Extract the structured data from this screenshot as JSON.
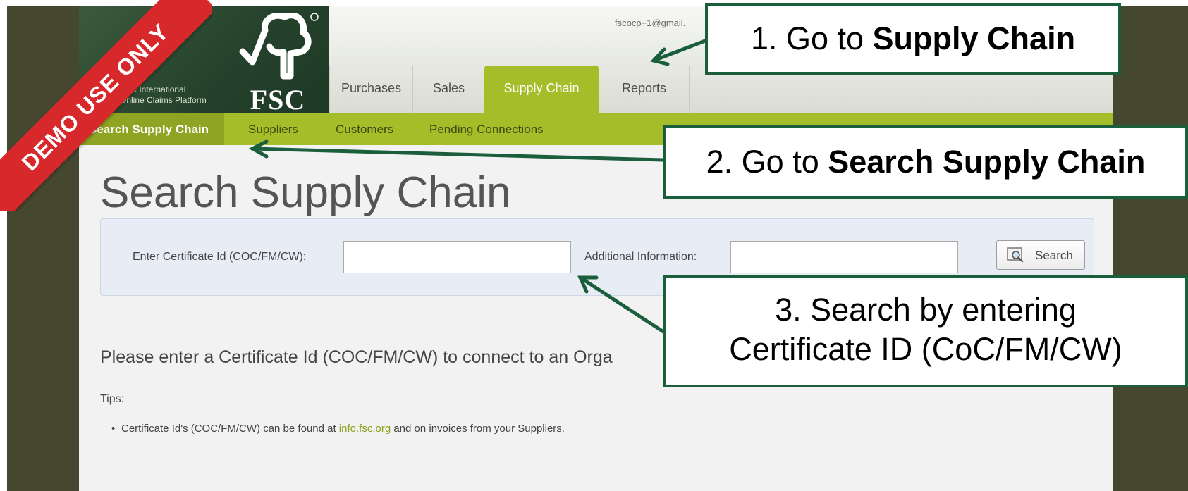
{
  "brand": {
    "name_line1": "FSC International",
    "name_line2": "Online Claims Platform",
    "logo_text": "FSC",
    "registered_mark": "®"
  },
  "header": {
    "email": "fscocp+1@gmail."
  },
  "tabs": [
    {
      "label": "Purchases",
      "active": false
    },
    {
      "label": "Sales",
      "active": false
    },
    {
      "label": "Supply Chain",
      "active": true
    },
    {
      "label": "Reports",
      "active": false
    }
  ],
  "subnav": [
    {
      "label": "Search Supply Chain",
      "active": true
    },
    {
      "label": "Suppliers",
      "active": false
    },
    {
      "label": "Customers",
      "active": false
    },
    {
      "label": "Pending Connections",
      "active": false
    }
  ],
  "main": {
    "title": "Search Supply Chain",
    "certificate_label": "Enter Certificate Id (COC/FM/CW):",
    "certificate_value": "",
    "additional_label": "Additional Information:",
    "additional_value": "",
    "search_label": "Search",
    "message": "Please enter a Certificate Id (COC/FM/CW) to connect to an Orga",
    "tips_title": "Tips:",
    "tip_prefix": "Certificate Id's (COC/FM/CW) can be found at ",
    "tip_link": "info.fsc.org",
    "tip_suffix": " and on invoices from your Suppliers."
  },
  "ribbon": {
    "text": "DEMO USE ONLY"
  },
  "callouts": {
    "step1_prefix": "1. Go to ",
    "step1_bold": "Supply Chain",
    "step2_prefix": "2. Go to ",
    "step2_bold": "Search Supply Chain",
    "step3_line1": "3. Search by entering",
    "step3_line2": "Certificate ID (CoC/FM/CW)"
  },
  "colors": {
    "frame": "#45472f",
    "accent_green": "#a6bd2a",
    "ribbon_red": "#d7282b",
    "callout_border": "#1b5e3c",
    "link": "#8ba51e"
  },
  "icons": [
    "fsc-tree-logo",
    "magnifier-icon"
  ]
}
